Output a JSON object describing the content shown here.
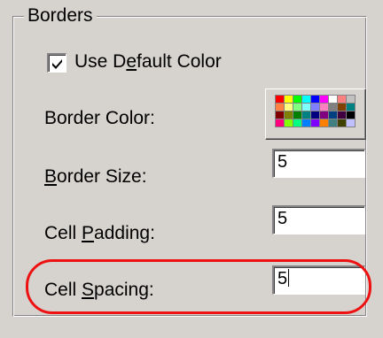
{
  "group": {
    "title": "Borders"
  },
  "use_default_color": {
    "checked": true,
    "label_pre": "Use D",
    "label_mnemonic": "e",
    "label_post": "fault Color"
  },
  "border_color": {
    "label": "Border Color:",
    "palette": [
      "#ff0000",
      "#ffff00",
      "#00ff00",
      "#00ffff",
      "#0000ff",
      "#ff00ff",
      "#ffffff",
      "#ff8080",
      "#c0c0c0",
      "#ff8040",
      "#ffff80",
      "#80ff80",
      "#80ffff",
      "#8080ff",
      "#ff80c0",
      "#808080",
      "#804000",
      "#008080",
      "#800000",
      "#808000",
      "#008000",
      "#008080",
      "#000080",
      "#800080",
      "#004080",
      "#400040",
      "#000000",
      "#ff0080",
      "#80ff00",
      "#00ff80",
      "#0080ff",
      "#8000ff",
      "#ff8000",
      "#408080",
      "#404000",
      "#c0c0ff"
    ]
  },
  "border_size": {
    "label_mnemonic": "B",
    "label_post": "order Size:",
    "value": "5"
  },
  "cell_padding": {
    "label_pre": "Cell ",
    "label_mnemonic": "P",
    "label_post": "adding:",
    "value": "5"
  },
  "cell_spacing": {
    "label_pre": "Cell ",
    "label_mnemonic": "S",
    "label_post": "pacing:",
    "value": "5"
  },
  "colors": {
    "highlight": "#ee1111",
    "dialog_face": "#d6d3ce"
  }
}
